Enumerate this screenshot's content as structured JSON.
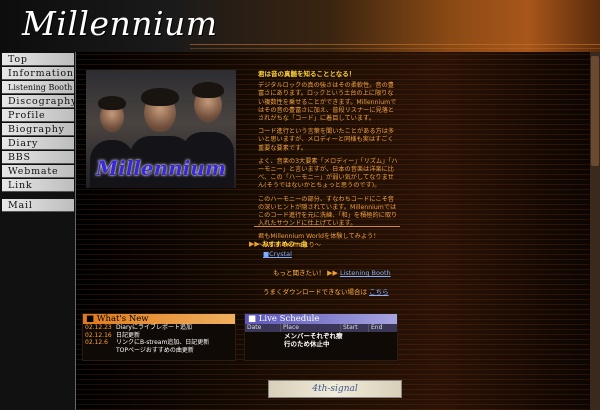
{
  "site": {
    "title": "Millennium"
  },
  "nav": {
    "items": [
      {
        "label": "Top"
      },
      {
        "label": "Information"
      },
      {
        "label": "Listening Booth"
      },
      {
        "label": "Discography"
      },
      {
        "label": "Profile"
      },
      {
        "label": "Biography"
      },
      {
        "label": "Diary"
      },
      {
        "label": "BBS"
      },
      {
        "label": "Webmate"
      },
      {
        "label": "Link"
      }
    ],
    "mail": "Mail"
  },
  "photo": {
    "logo_text": "Millennium"
  },
  "intro": {
    "heading": "君は音の真髄を知ることとなる！",
    "p1": "デジタルロックの真の強さはその柔軟性。音の豊富さにあります。ロックという土台の上に限りない複数性を乗せることができます。Millenniumではその音の豊富さに加え、普段リスナーに見落とされがちな「コード」に着目しています。",
    "p2": "コード進行という言葉を聞いたことがある方は多いと思いますが、メロディーと同様も実はすごく重要な要素です。",
    "p3": "よく、音楽の3大要素「メロディー」「リズム」「ハーモニー」と言いますが、日本の音楽は洋楽に比べ、この「ハーモニー」が弱い気がしてなりません(そうではないかとちょっと思うのです)。",
    "p4": "このハーモニーの部分、すなわちコードにこそ音の深いヒントが隠されています。Millenniumではこのコード進行を元に洗練、「和」を積極的に取り入れたサウンドに仕上げています。",
    "p5": "君もMillennium Worldを体験してみよう！",
    "signature": "〜Wsim Profileより〜"
  },
  "song": {
    "header": "おすすめの一曲",
    "title": "■Crystal",
    "listen_prompt": "もっと聞きたい！",
    "listen_link": "Listening Booth",
    "download_prompt": "うまくダウンロードできない場合は",
    "download_link": "こちら"
  },
  "news": {
    "title": "What's New",
    "items": [
      {
        "date": "02.12.23",
        "text": "Diaryにライブレポート追加"
      },
      {
        "date": "02.12.16",
        "text": "日記更新"
      },
      {
        "date": "02.12.6",
        "text": "リンクにB-stream追加、日記更新"
      },
      {
        "date": "",
        "text": "TOPページおすすめの曲更新"
      }
    ]
  },
  "schedule": {
    "title": "Live Schedule",
    "columns": [
      "Date",
      "Place",
      "Start",
      "End"
    ],
    "notice_line1": "メンバーそれぞれ療",
    "notice_line2": "行のため休止中"
  },
  "footer": {
    "banner": "4th-signal"
  },
  "colors": {
    "accent": "#f0a040",
    "nav_bg": "#d6d6d6",
    "news_head": "#e07a1a",
    "schedule_head": "#5a56b8"
  }
}
